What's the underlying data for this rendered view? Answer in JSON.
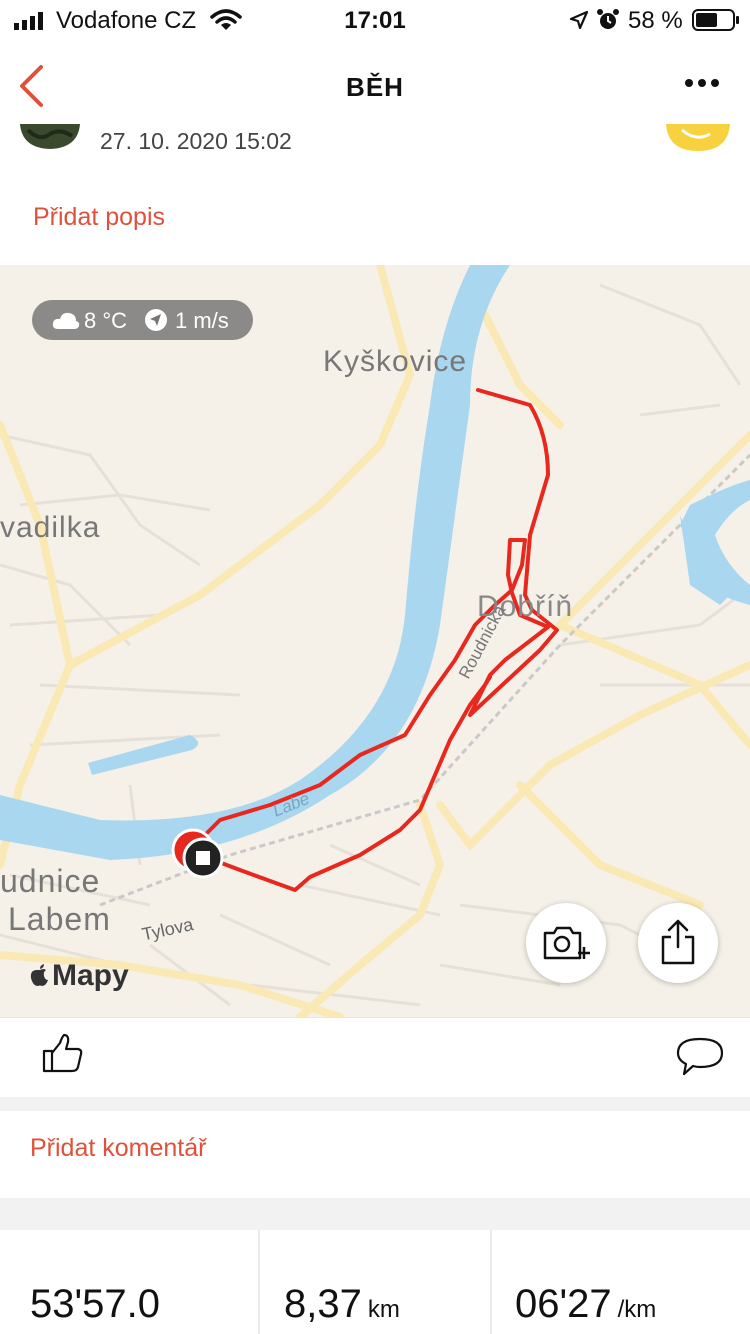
{
  "status_bar": {
    "carrier": "Vodafone CZ",
    "time": "17:01",
    "battery_percent": "58 %"
  },
  "nav": {
    "title": "BĚH"
  },
  "activity": {
    "date": "27. 10. 2020 15:02",
    "add_description": "Přidat popis"
  },
  "map": {
    "weather": {
      "temperature": "8 °C",
      "wind": "1 m/s"
    },
    "labels": {
      "kyskovice": "Kyškovice",
      "vadilka": "vadilka",
      "dobrin": "Dobříň",
      "roudnicka": "Roudnická",
      "labe": "Labe",
      "udnice": "udnice",
      "labem": "Labem",
      "tylova": "Tylova"
    },
    "brand": "Mapy",
    "colors": {
      "water": "#a9d7ef",
      "land": "#f5f1e9",
      "road": "#fbe9b5",
      "route": "#e8281f"
    }
  },
  "comments": {
    "add_comment": "Přidat komentář"
  },
  "stats": [
    {
      "value": "53'57.0",
      "unit": ""
    },
    {
      "value": "8,37",
      "unit": "km"
    },
    {
      "value": "06'27",
      "unit": "/km"
    }
  ],
  "accent_color": "#e0513c"
}
